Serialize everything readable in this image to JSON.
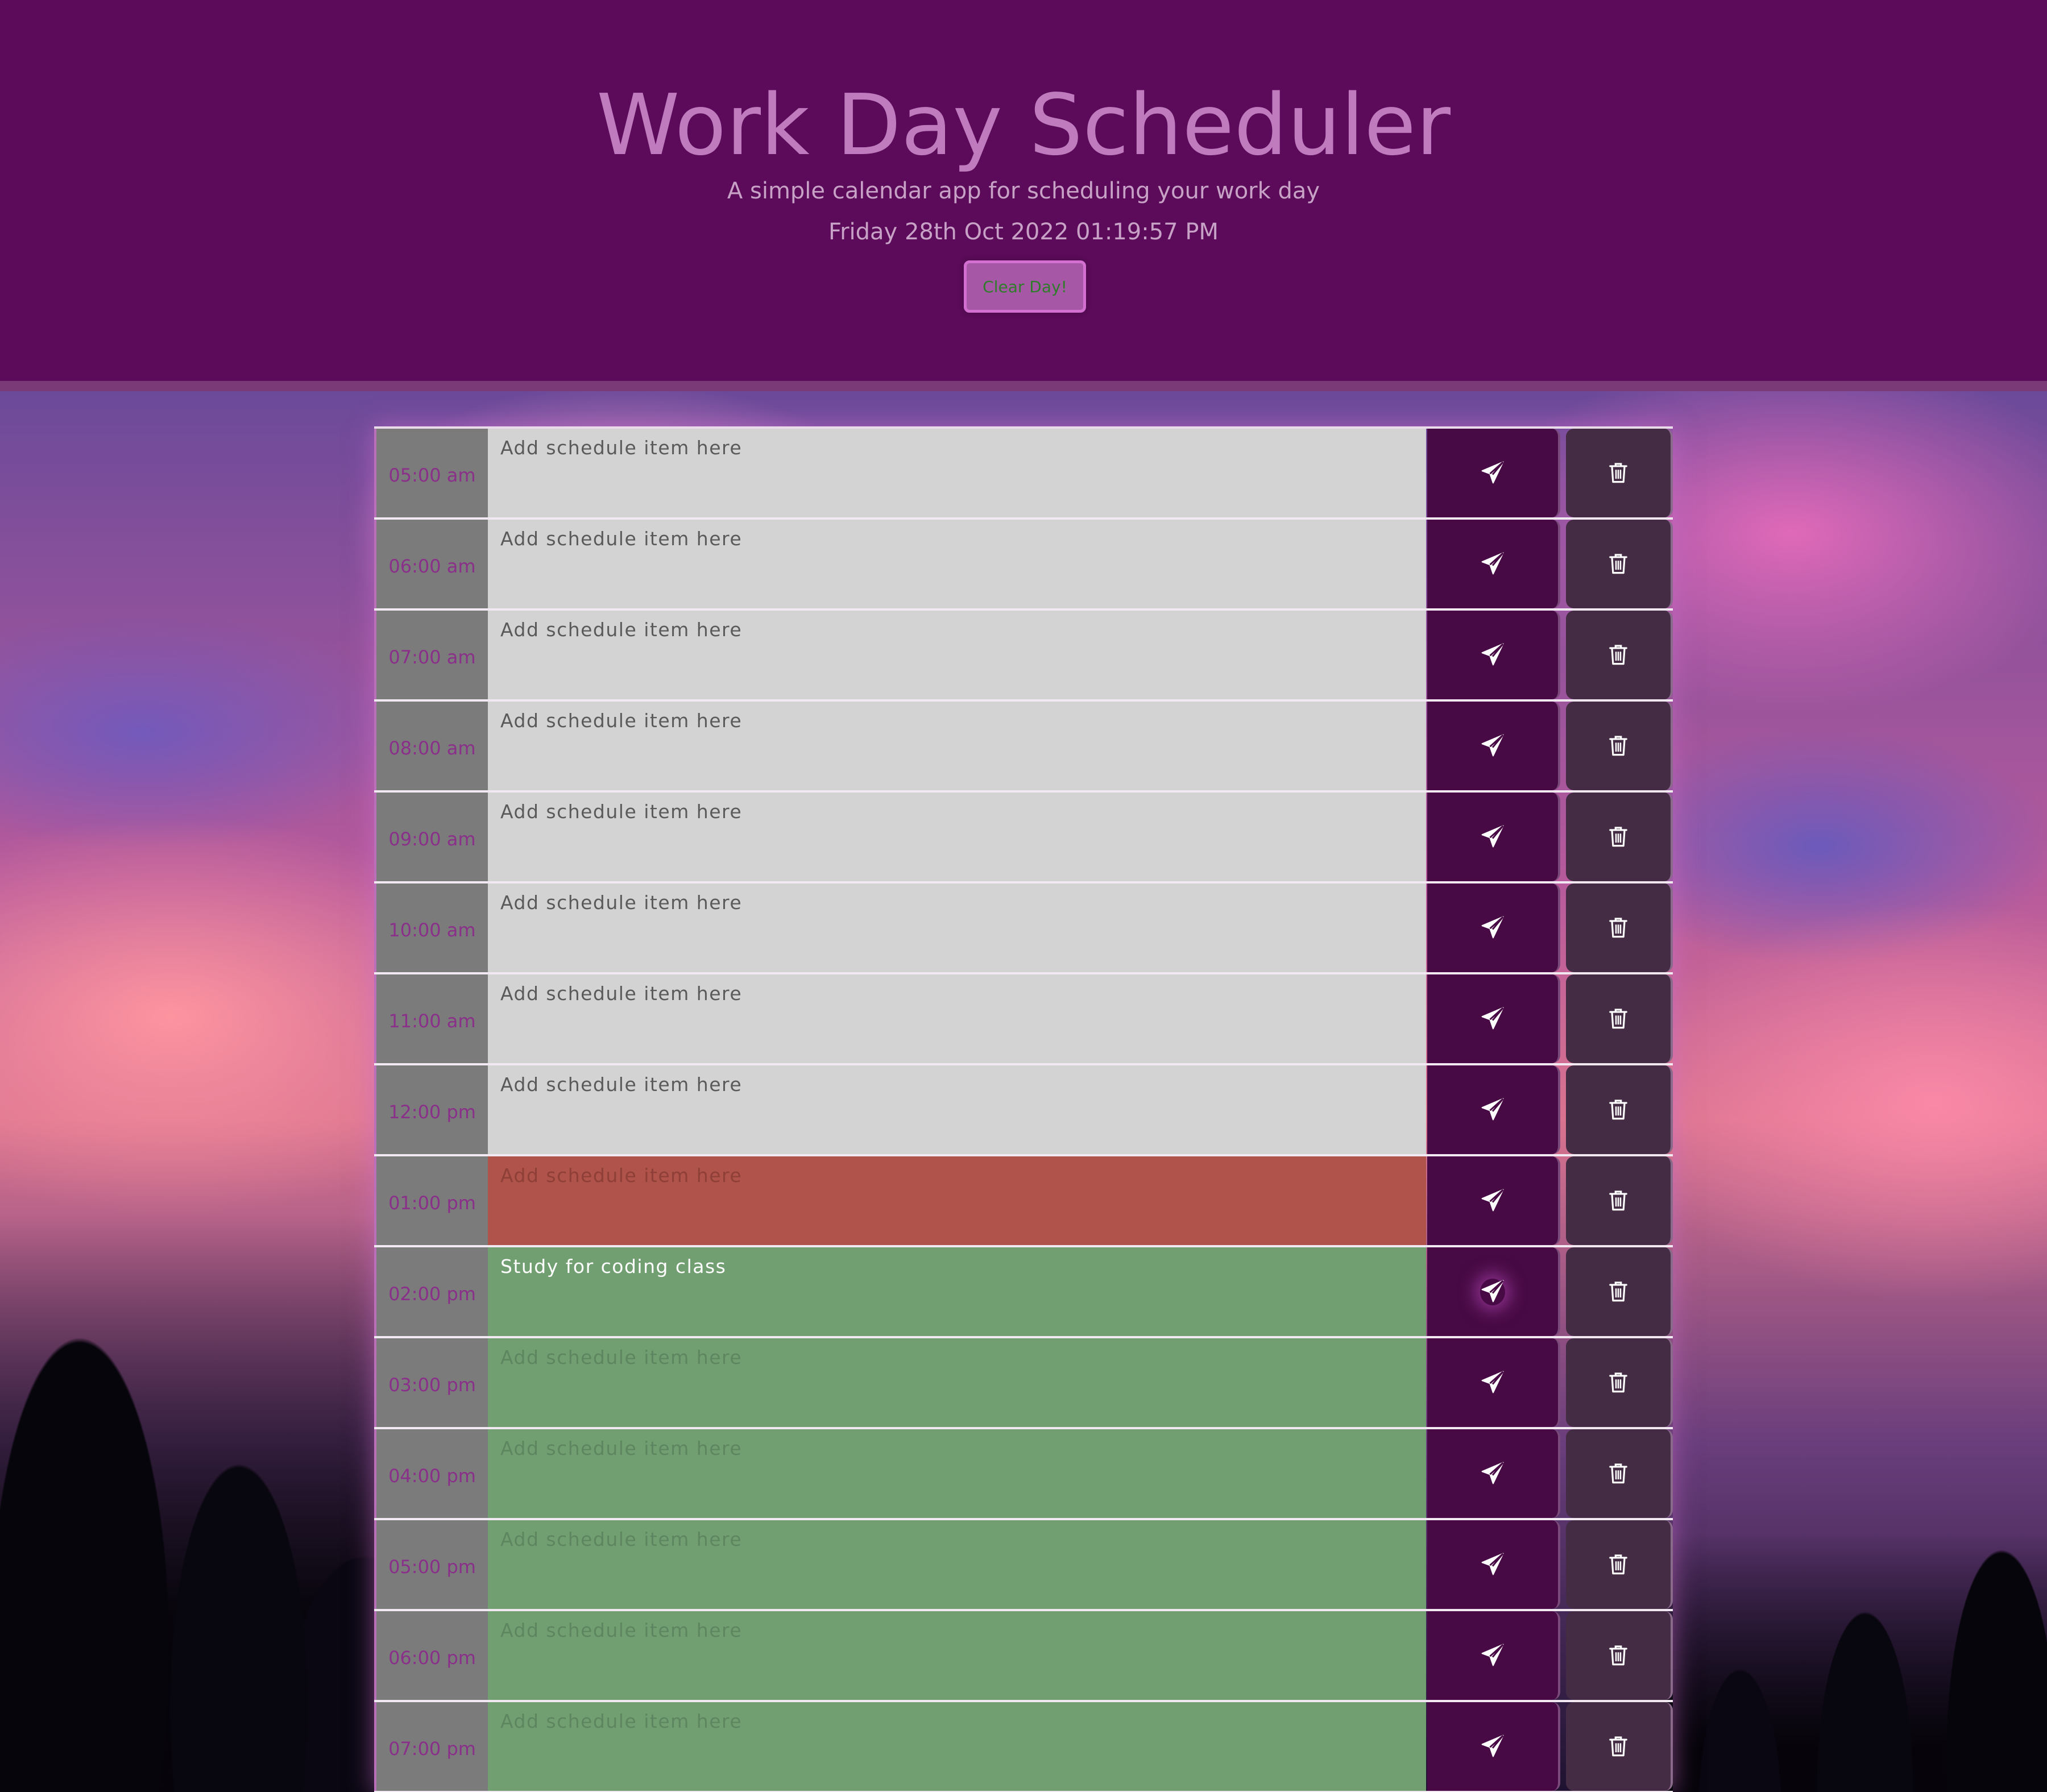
{
  "header": {
    "title": "Work Day Scheduler",
    "subtitle": "A simple calendar app for scheduling your work day",
    "current_datetime": "Friday 28th Oct 2022 01:19:57 PM",
    "clear_button_label": "Clear Day!"
  },
  "placeholder": "Add schedule item here",
  "rows": [
    {
      "hour": "05:00 am",
      "status": "past",
      "value": ""
    },
    {
      "hour": "06:00 am",
      "status": "past",
      "value": ""
    },
    {
      "hour": "07:00 am",
      "status": "past",
      "value": ""
    },
    {
      "hour": "08:00 am",
      "status": "past",
      "value": ""
    },
    {
      "hour": "09:00 am",
      "status": "past",
      "value": ""
    },
    {
      "hour": "10:00 am",
      "status": "past",
      "value": ""
    },
    {
      "hour": "11:00 am",
      "status": "past",
      "value": ""
    },
    {
      "hour": "12:00 pm",
      "status": "past",
      "value": ""
    },
    {
      "hour": "01:00 pm",
      "status": "present",
      "value": ""
    },
    {
      "hour": "02:00 pm",
      "status": "future",
      "value": "Study for coding class"
    },
    {
      "hour": "03:00 pm",
      "status": "future",
      "value": ""
    },
    {
      "hour": "04:00 pm",
      "status": "future",
      "value": ""
    },
    {
      "hour": "05:00 pm",
      "status": "future",
      "value": ""
    },
    {
      "hour": "06:00 pm",
      "status": "future",
      "value": ""
    },
    {
      "hour": "07:00 pm",
      "status": "future",
      "value": ""
    }
  ],
  "icons": {
    "save": "paper-plane-icon",
    "delete": "trash-icon"
  },
  "colors": {
    "header_bg": "#5b0b59",
    "past": "#d3d3d3",
    "present": "#b0534a",
    "future": "#729f72",
    "save_button": "#470a44",
    "delete_button": "#452c45"
  }
}
